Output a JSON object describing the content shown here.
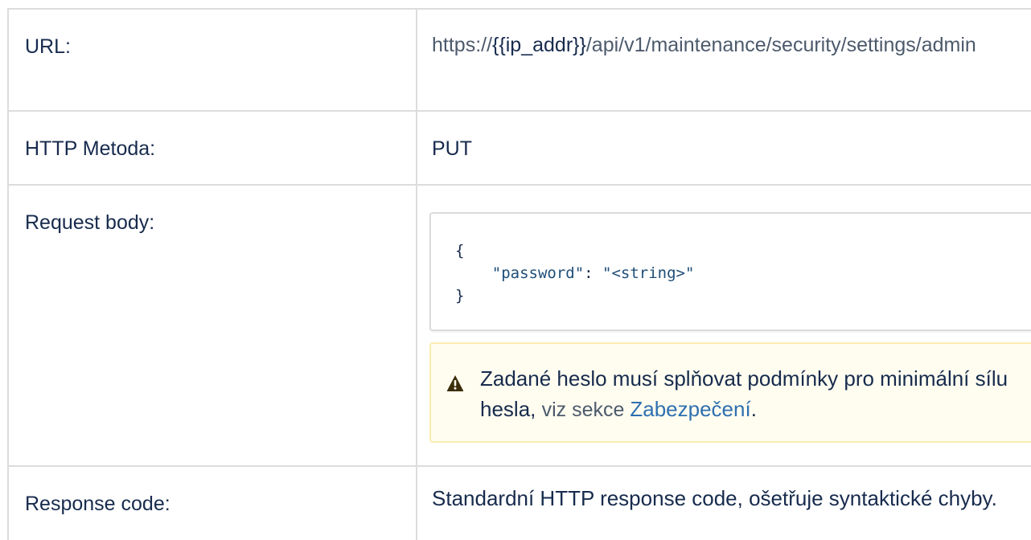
{
  "table": {
    "rows": [
      {
        "label": "URL:",
        "url_prefix": "https://",
        "url_highlight": "{{ip_addr}}",
        "url_suffix": "/api/v1/maintenance/security/settings/admin"
      },
      {
        "label": "HTTP Metoda:",
        "value": "PUT"
      },
      {
        "label": "Request body:",
        "code": {
          "open_brace": "{",
          "indent": "    ",
          "key": "\"password\"",
          "colon": ": ",
          "value": "\"<string>\"",
          "close_brace": "}"
        },
        "warning": {
          "icon": "warning-triangle-icon",
          "text": "Zadané heslo musí splňovat podmínky pro minimální sílu hesla, ",
          "viz": "viz sekce ",
          "link": "Zabezpečení",
          "after": "."
        }
      },
      {
        "label": "Response code:",
        "value": "Standardní HTTP response code, ošetřuje syntaktické chyby."
      }
    ]
  },
  "colors": {
    "border": "#dcdcdc",
    "text": "#172b4d",
    "muted_text": "#4c5a6c",
    "link": "#2f6fb0",
    "warning_bg": "#fffdf0",
    "warning_border": "#fbecb0"
  }
}
